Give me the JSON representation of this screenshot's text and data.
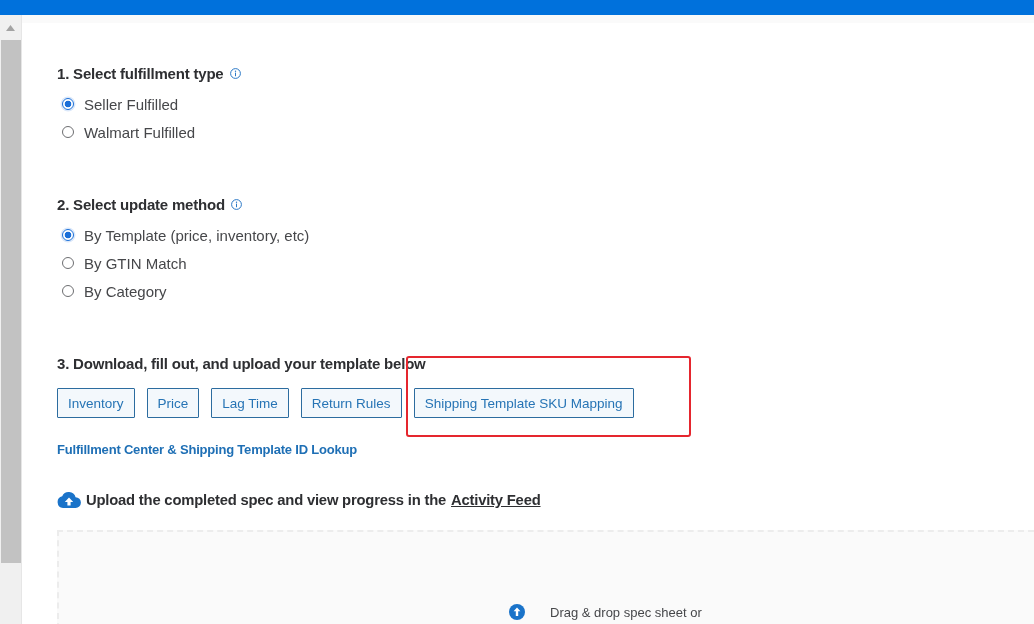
{
  "fulfillment_type": {
    "title": "1. Select fulfillment type",
    "info_icon": true,
    "options": [
      {
        "label": "Seller Fulfilled",
        "selected": true
      },
      {
        "label": "Walmart Fulfilled",
        "selected": false
      }
    ]
  },
  "update_method": {
    "title": "2. Select update method",
    "info_icon": true,
    "options": [
      {
        "label": "By Template (price, inventory, etc)",
        "selected": true
      },
      {
        "label": "By GTIN Match",
        "selected": false
      },
      {
        "label": "By Category",
        "selected": false
      }
    ]
  },
  "template_download": {
    "title": "3. Download, fill out, and upload your template below",
    "buttons": [
      {
        "label": "Inventory",
        "annotated": false
      },
      {
        "label": "Price",
        "annotated": false
      },
      {
        "label": "Lag Time",
        "annotated": false
      },
      {
        "label": "Return Rules",
        "annotated": false
      },
      {
        "label": "Shipping Template SKU Mapping",
        "annotated": true
      }
    ],
    "lookup_link": "Fulfillment Center & Shipping Template ID Lookup"
  },
  "upload": {
    "text": "Upload the completed spec and view progress in the",
    "link": "Activity Feed",
    "dropzone_text": "Drag & drop spec sheet or"
  }
}
